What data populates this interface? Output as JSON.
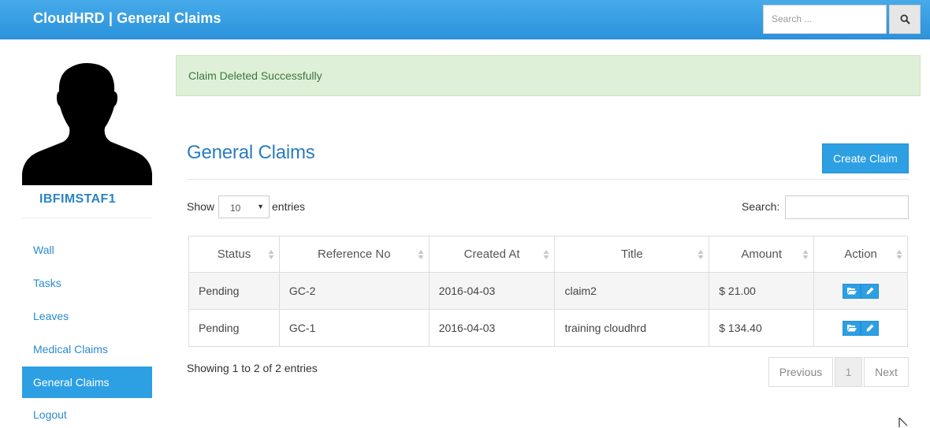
{
  "header": {
    "brand": "CloudHRD | General Claims",
    "search_placeholder": "Search ..."
  },
  "sidebar": {
    "username": "IBFIMSTAF1",
    "items": [
      {
        "label": "Wall",
        "active": false
      },
      {
        "label": "Tasks",
        "active": false
      },
      {
        "label": "Leaves",
        "active": false
      },
      {
        "label": "Medical Claims",
        "active": false
      },
      {
        "label": "General Claims",
        "active": true
      },
      {
        "label": "Logout",
        "active": false
      }
    ]
  },
  "alert": {
    "text": "Claim Deleted Successfully"
  },
  "page": {
    "title": "General Claims",
    "create_label": "Create Claim"
  },
  "table_controls": {
    "show_label": "Show",
    "entries_value": "10",
    "entries_label": "entries",
    "search_label": "Search:"
  },
  "table": {
    "columns": [
      "Status",
      "Reference No",
      "Created At",
      "Title",
      "Amount",
      "Action"
    ],
    "rows": [
      {
        "status": "Pending",
        "ref": "GC-2",
        "created": "2016-04-03",
        "title": "claim2",
        "amount": "$ 21.00"
      },
      {
        "status": "Pending",
        "ref": "GC-1",
        "created": "2016-04-03",
        "title": "training cloudhrd",
        "amount": "$ 134.40"
      }
    ]
  },
  "footer": {
    "info": "Showing 1 to 2 of 2 entries",
    "prev": "Previous",
    "page": "1",
    "next": "Next"
  },
  "colors": {
    "primary": "#2d9fe3",
    "alert_bg": "#dff0d8",
    "alert_text": "#3c763d"
  },
  "icons": [
    "search-icon",
    "folder-open-icon",
    "pencil-icon",
    "sort-icon"
  ]
}
